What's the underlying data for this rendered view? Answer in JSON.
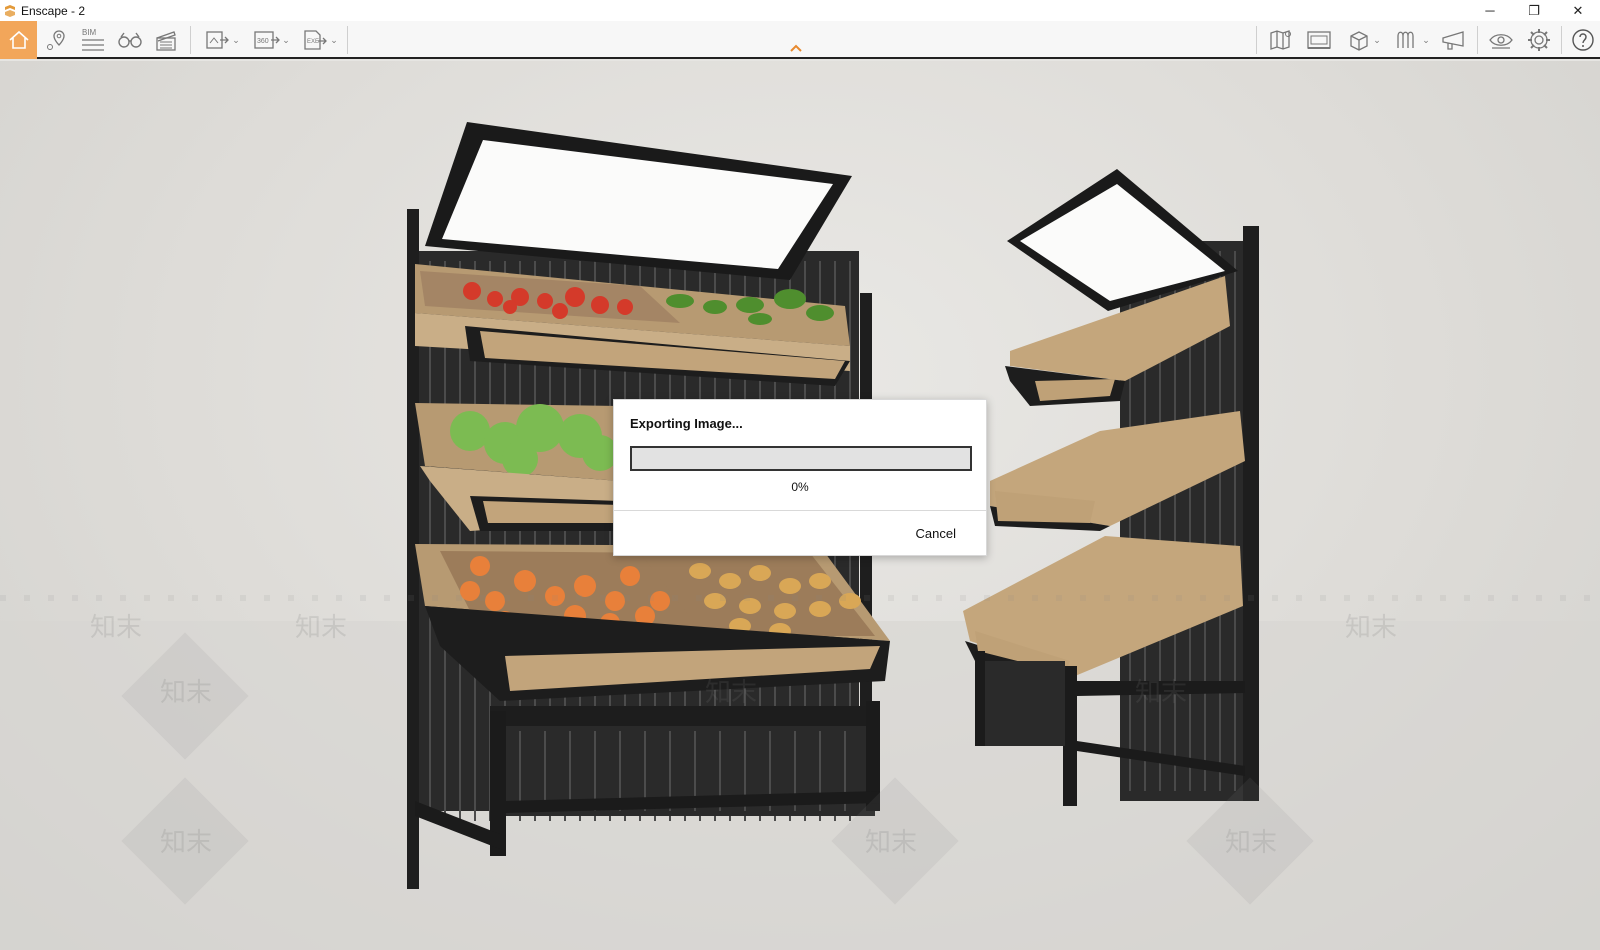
{
  "window": {
    "title": "Enscape - 2",
    "controls": {
      "minimize": "─",
      "restore": "❐",
      "close": "✕"
    }
  },
  "toolbar": {
    "left_icons": [
      "home-icon",
      "location-pin-icon",
      "bim-icon",
      "binoculars-icon",
      "clapperboard-icon"
    ],
    "bim_label": "BIM",
    "export_icons": [
      "render-export-icon",
      "panorama-360-export-icon",
      "exe-export-icon"
    ],
    "panorama_label": "360",
    "exe_label": "EXE",
    "right_icons": [
      "map-icon",
      "asset-library-icon",
      "cube-view-icon",
      "material-icon",
      "feedback-icon",
      "visibility-eye-icon",
      "settings-gear-icon",
      "help-icon"
    ],
    "accent_color": "#f2a65a"
  },
  "dialog": {
    "title": "Exporting Image...",
    "progress_percent": 0,
    "progress_text": "0%",
    "cancel_label": "Cancel"
  },
  "viewport": {
    "watermark_text": "知末"
  }
}
